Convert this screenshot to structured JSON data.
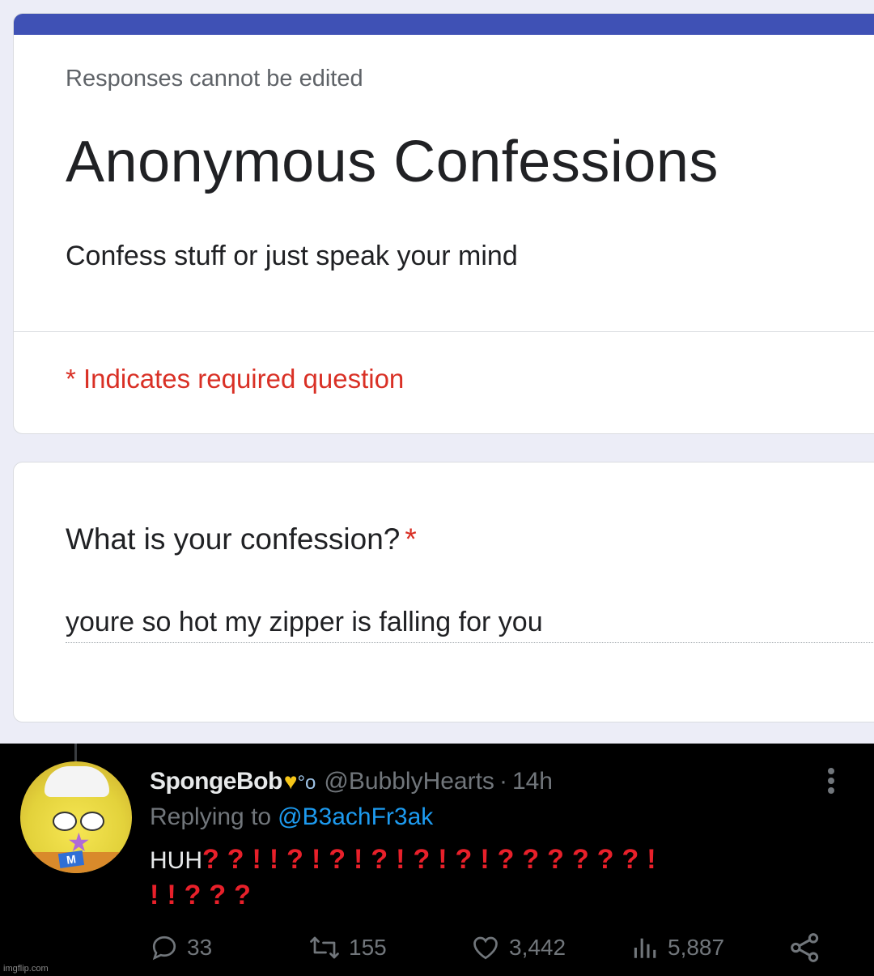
{
  "form": {
    "accent_color": "#3f51b5",
    "note": "Responses cannot be edited",
    "title": "Anonymous Confessions",
    "description": "Confess stuff or just speak your mind",
    "required_notice": "* Indicates required question",
    "question": {
      "label": "What is your confession?",
      "required_mark": "*",
      "answer": "youre so hot my zipper is falling for you"
    }
  },
  "tweet": {
    "display_name": "SpongeBob",
    "name_emojis": [
      "yellow-heart-icon",
      "bubbles-icon"
    ],
    "handle": "@BubblyHearts",
    "separator": "·",
    "time": "14h",
    "replying_prefix": "Replying to",
    "replying_to": "@B3achFr3ak",
    "text": "HUH",
    "marks_line1": "??!!?!?!?!?!?!??????!",
    "marks_line2": "!!???",
    "marks_color": "#e8202a",
    "link_color": "#1d9bf0",
    "stats": {
      "replies": "33",
      "retweets": "155",
      "likes": "3,442",
      "views": "5,887"
    }
  },
  "watermark": "imgflip.com"
}
